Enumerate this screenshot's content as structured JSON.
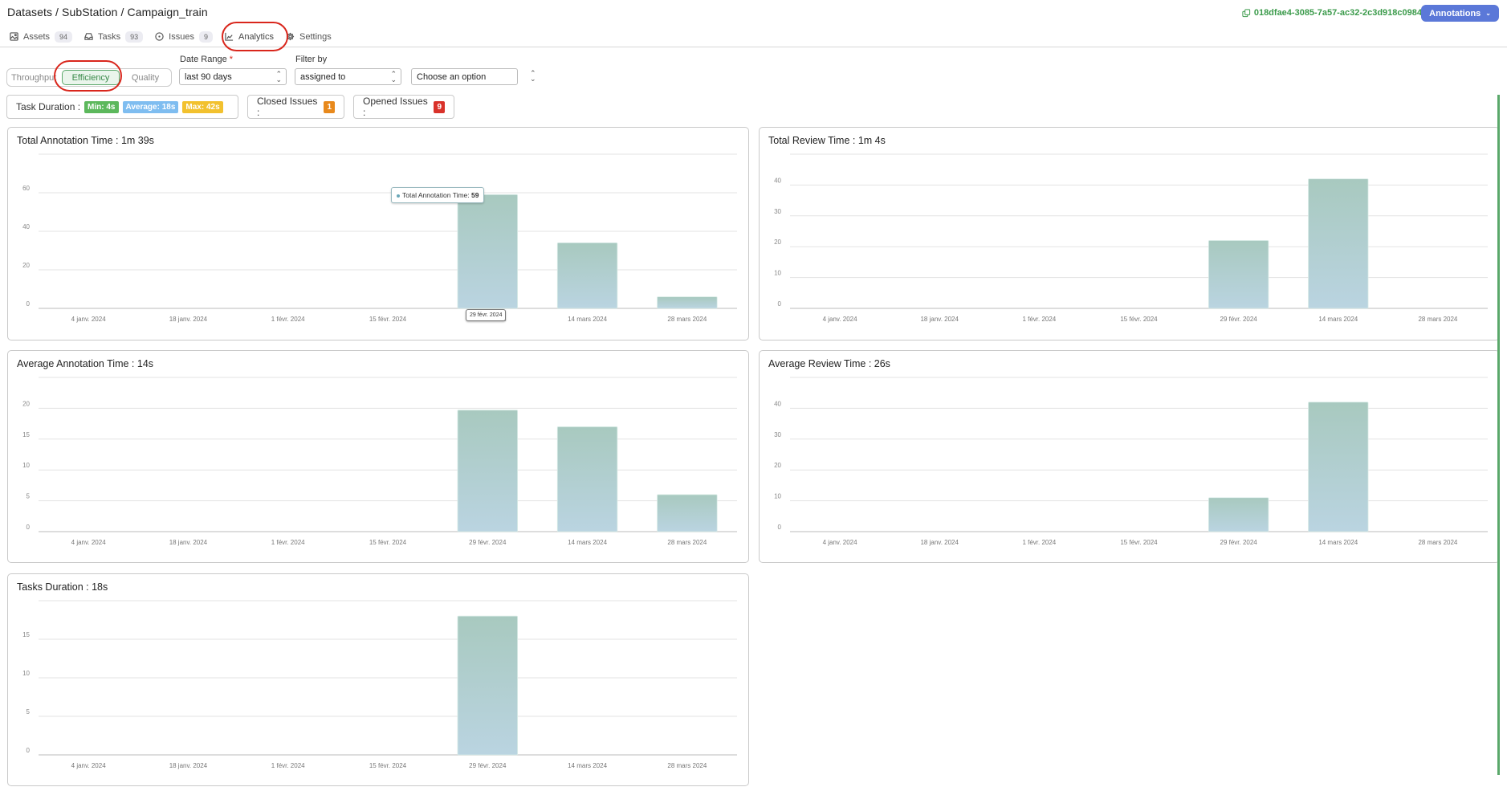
{
  "header": {
    "breadcrumb": "Datasets / SubStation / Campaign_train",
    "dataset_id": "018dfae4-3085-7a57-ac32-2c3d918c0984",
    "annotations_button": "Annotations"
  },
  "tabs": [
    {
      "label": "Assets",
      "count": "94",
      "icon": "image-icon"
    },
    {
      "label": "Tasks",
      "count": "93",
      "icon": "inbox-icon"
    },
    {
      "label": "Issues",
      "count": "9",
      "icon": "circle-dot-icon"
    },
    {
      "label": "Analytics",
      "count": null,
      "icon": "chart-line-icon",
      "active": true
    },
    {
      "label": "Settings",
      "count": null,
      "icon": "gear-icon"
    }
  ],
  "controls": {
    "views": [
      "Throughput",
      "Efficiency",
      "Quality"
    ],
    "selected_view": "Efficiency",
    "date_range_label": "Date Range",
    "date_range_required": "*",
    "date_range_value": "last 90 days",
    "filter_by_label": "Filter by",
    "filter_by_value": "assigned to",
    "option_placeholder": "Choose an option"
  },
  "stats": {
    "task_duration_label": "Task Duration :",
    "min": "Min: 4s",
    "average": "Average: 18s",
    "max": "Max: 42s",
    "closed_issues_label": "Closed Issues :",
    "closed_issues": "1",
    "opened_issues_label": "Opened Issues :",
    "opened_issues": "9",
    "colors": {
      "min": "#5cb85c",
      "average": "#7fbdf0",
      "max": "#f2c12e",
      "closed": "#e8891c",
      "opened": "#d9322a"
    }
  },
  "chart_data": [
    {
      "id": "total-annotation-time",
      "type": "bar",
      "title": "Total Annotation Time : 1m 39s",
      "categories": [
        "4 janv. 2024",
        "18 janv. 2024",
        "1 févr. 2024",
        "15 févr. 2024",
        "29 févr. 2024",
        "14 mars 2024",
        "28 mars 2024"
      ],
      "values": [
        0,
        0,
        0,
        0,
        59,
        34,
        6
      ],
      "yticks": [
        0,
        20,
        40,
        60
      ],
      "ylim": [
        0,
        80
      ],
      "tooltip": {
        "label": "Total Annotation Time:",
        "value": "59",
        "category": "29 févr. 2024"
      }
    },
    {
      "id": "total-review-time",
      "type": "bar",
      "title": "Total Review Time : 1m 4s",
      "categories": [
        "4 janv. 2024",
        "18 janv. 2024",
        "1 févr. 2024",
        "15 févr. 2024",
        "29 févr. 2024",
        "14 mars 2024",
        "28 mars 2024"
      ],
      "values": [
        0,
        0,
        0,
        0,
        22,
        42,
        0
      ],
      "yticks": [
        0,
        10,
        20,
        30,
        40
      ],
      "ylim": [
        0,
        50
      ]
    },
    {
      "id": "average-annotation-time",
      "type": "bar",
      "title": "Average Annotation Time : 14s",
      "categories": [
        "4 janv. 2024",
        "18 janv. 2024",
        "1 févr. 2024",
        "15 févr. 2024",
        "29 févr. 2024",
        "14 mars 2024",
        "28 mars 2024"
      ],
      "values": [
        0,
        0,
        0,
        0,
        19.7,
        17,
        6
      ],
      "yticks": [
        0,
        5,
        10,
        15,
        20
      ],
      "ylim": [
        0,
        25
      ]
    },
    {
      "id": "average-review-time",
      "type": "bar",
      "title": "Average Review Time : 26s",
      "categories": [
        "4 janv. 2024",
        "18 janv. 2024",
        "1 févr. 2024",
        "15 févr. 2024",
        "29 févr. 2024",
        "14 mars 2024",
        "28 mars 2024"
      ],
      "values": [
        0,
        0,
        0,
        0,
        11,
        42,
        0
      ],
      "yticks": [
        0,
        10,
        20,
        30,
        40
      ],
      "ylim": [
        0,
        50
      ]
    },
    {
      "id": "tasks-duration",
      "type": "bar",
      "title": "Tasks Duration : 18s",
      "categories": [
        "4 janv. 2024",
        "18 janv. 2024",
        "1 févr. 2024",
        "15 févr. 2024",
        "29 févr. 2024",
        "14 mars 2024",
        "28 mars 2024"
      ],
      "values": [
        0,
        0,
        0,
        0,
        18,
        0,
        0
      ],
      "yticks": [
        0,
        5,
        10,
        15
      ],
      "ylim": [
        0,
        20
      ]
    }
  ]
}
